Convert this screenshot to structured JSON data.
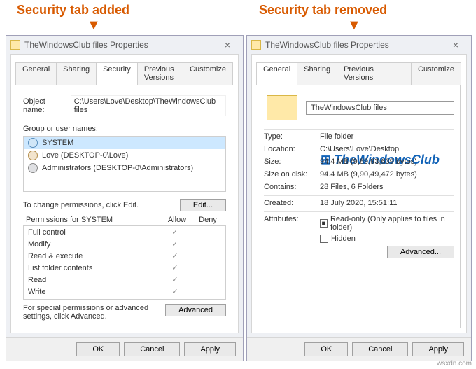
{
  "captions": {
    "added": "Security tab added",
    "removed": "Security tab removed"
  },
  "win1": {
    "title": "TheWindowsClub files Properties",
    "tabs": [
      "General",
      "Sharing",
      "Security",
      "Previous Versions",
      "Customize"
    ],
    "objectLabel": "Object name:",
    "objectValue": "C:\\Users\\Love\\Desktop\\TheWindowsClub files",
    "groupLabel": "Group or user names:",
    "users": [
      "SYSTEM",
      "Love (DESKTOP-0\\Love)",
      "Administrators (DESKTOP-0\\Administrators)"
    ],
    "changeText": "To change permissions, click Edit.",
    "editBtn": "Edit...",
    "permLabel": "Permissions for SYSTEM",
    "allow": "Allow",
    "deny": "Deny",
    "perms": [
      "Full control",
      "Modify",
      "Read & execute",
      "List folder contents",
      "Read",
      "Write"
    ],
    "specialText": "For special permissions or advanced settings, click Advanced.",
    "advancedBtn": "Advanced",
    "buttons": {
      "ok": "OK",
      "cancel": "Cancel",
      "apply": "Apply"
    }
  },
  "win2": {
    "title": "TheWindowsClub files Properties",
    "tabs": [
      "General",
      "Sharing",
      "Previous Versions",
      "Customize"
    ],
    "name": "TheWindowsClub files",
    "rows": {
      "typeL": "Type:",
      "typeV": "File folder",
      "locL": "Location:",
      "locV": "C:\\Users\\Love\\Desktop",
      "sizeL": "Size:",
      "sizeV": "94.4 MB (9,89,93,639 bytes)",
      "sodL": "Size on disk:",
      "sodV": "94.4 MB (9,90,49,472 bytes)",
      "contL": "Contains:",
      "contV": "28 Files, 6 Folders",
      "createdL": "Created:",
      "createdV": "18 July 2020, 15:51:11",
      "attrL": "Attributes:",
      "readonly": "Read-only (Only applies to files in folder)",
      "hidden": "Hidden",
      "advancedBtn": "Advanced..."
    },
    "buttons": {
      "ok": "OK",
      "cancel": "Cancel",
      "apply": "Apply"
    }
  },
  "watermark": "TheWindowsClub",
  "credit": "wsxdn.com"
}
